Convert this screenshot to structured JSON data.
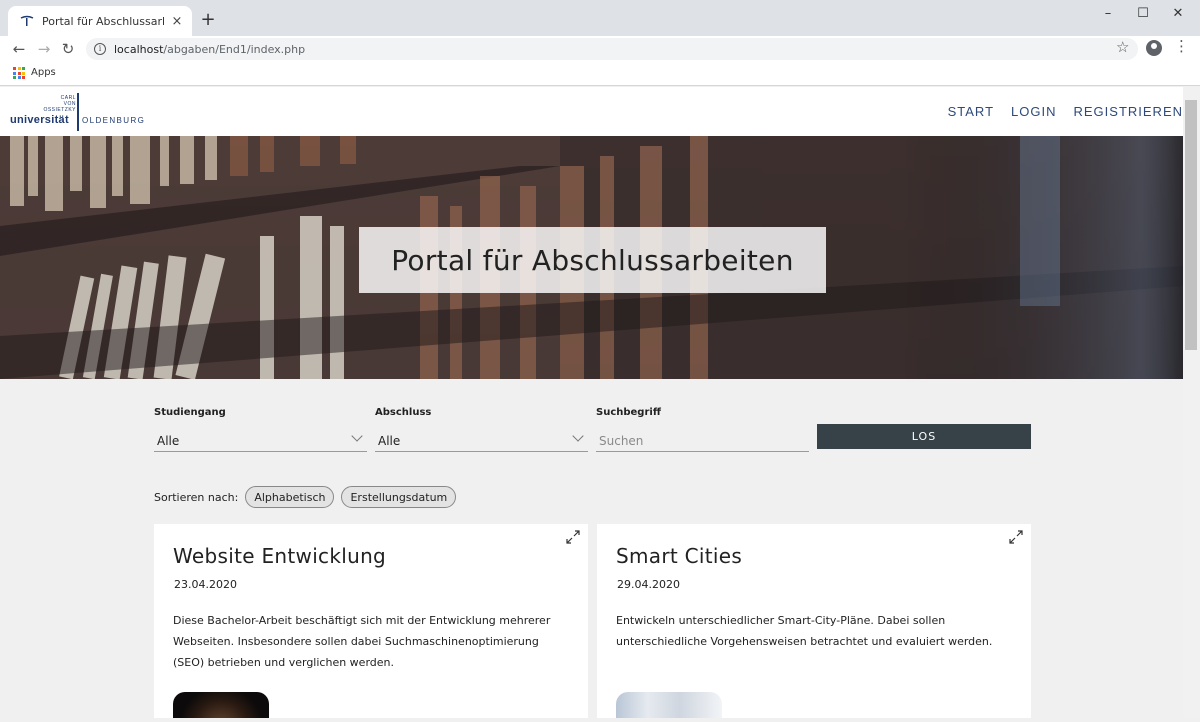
{
  "browser": {
    "tab_title": "Portal für Abschlussarbeiten | Uni",
    "tab_close": "×",
    "new_tab": "+",
    "url_host": "localhost",
    "url_path": "/abgaben/End1/index.php",
    "bookmark_apps": "Apps",
    "win_minimize": "–",
    "win_maximize": "☐",
    "win_close": "✕"
  },
  "site": {
    "logo": {
      "line1": "CARL",
      "line2": "VON",
      "line3": "OSSIETZKY",
      "uni": "universität",
      "city": "OLDENBURG"
    },
    "nav": [
      {
        "label": "START"
      },
      {
        "label": "LOGIN"
      },
      {
        "label": "REGISTRIEREN"
      }
    ],
    "hero_title": "Portal für Abschlussarbeiten"
  },
  "filters": {
    "studiengang": {
      "label": "Studiengang",
      "value": "Alle"
    },
    "abschluss": {
      "label": "Abschluss",
      "value": "Alle"
    },
    "suchbegriff": {
      "label": "Suchbegriff",
      "placeholder": "Suchen"
    },
    "submit_label": "LOS"
  },
  "sort": {
    "label": "Sortieren nach:",
    "options": [
      "Alphabetisch",
      "Erstellungsdatum"
    ]
  },
  "cards": [
    {
      "title": "Website Entwicklung",
      "date": "23.04.2020",
      "description": "Diese Bachelor-Arbeit beschäftigt sich mit der Entwicklung mehrerer Webseiten. Insbesondere sollen dabei Suchmaschinenoptimierung (SEO) betrieben und verglichen werden."
    },
    {
      "title": "Smart Cities",
      "date": "29.04.2020",
      "description": "Entwickeln unterschiedlicher Smart-City-Pläne. Dabei sollen unterschiedliche Vorgehensweisen betrachtet und evaluiert werden."
    }
  ],
  "colors": {
    "nav": "#2e4a7a",
    "button": "#364148",
    "logo": "#1f3a70"
  }
}
